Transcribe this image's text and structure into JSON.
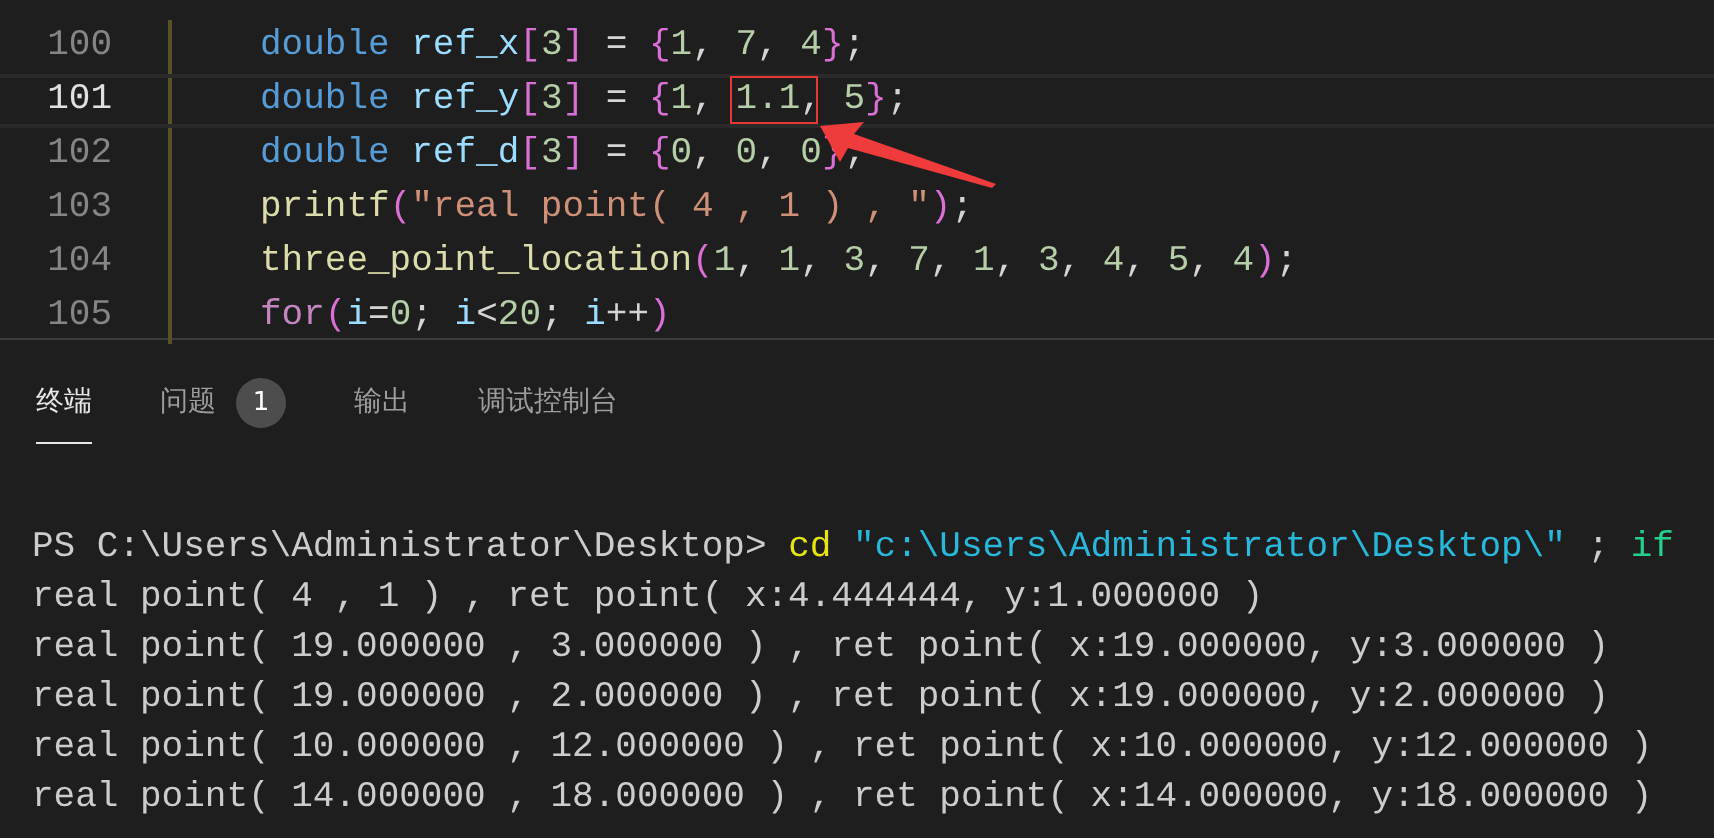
{
  "editor": {
    "lines": [
      {
        "number": "100",
        "current": false,
        "tokens": [
          {
            "kind": "keyword",
            "text": "double "
          },
          {
            "kind": "variable",
            "text": "ref_x"
          },
          {
            "kind": "bracket",
            "text": "["
          },
          {
            "kind": "number",
            "text": "3"
          },
          {
            "kind": "bracket",
            "text": "]"
          },
          {
            "kind": "punct",
            "text": " = "
          },
          {
            "kind": "bracket",
            "text": "{"
          },
          {
            "kind": "number",
            "text": "1"
          },
          {
            "kind": "punct",
            "text": ", "
          },
          {
            "kind": "number",
            "text": "7"
          },
          {
            "kind": "punct",
            "text": ", "
          },
          {
            "kind": "number",
            "text": "4"
          },
          {
            "kind": "bracket",
            "text": "}"
          },
          {
            "kind": "punct",
            "text": ";"
          }
        ]
      },
      {
        "number": "101",
        "current": true,
        "tokens": [
          {
            "kind": "keyword",
            "text": "double "
          },
          {
            "kind": "variable",
            "text": "ref_y"
          },
          {
            "kind": "bracket",
            "text": "["
          },
          {
            "kind": "number",
            "text": "3"
          },
          {
            "kind": "bracket",
            "text": "]"
          },
          {
            "kind": "punct",
            "text": " = "
          },
          {
            "kind": "bracket",
            "text": "{"
          },
          {
            "kind": "number",
            "text": "1"
          },
          {
            "kind": "punct",
            "text": ", "
          },
          {
            "kind": "number",
            "text": "1.1",
            "highlighted": true
          },
          {
            "kind": "punct",
            "text": ", "
          },
          {
            "kind": "number",
            "text": "5"
          },
          {
            "kind": "bracket",
            "text": "}"
          },
          {
            "kind": "punct",
            "text": ";"
          }
        ]
      },
      {
        "number": "102",
        "current": false,
        "tokens": [
          {
            "kind": "keyword",
            "text": "double "
          },
          {
            "kind": "variable",
            "text": "ref_d"
          },
          {
            "kind": "bracket",
            "text": "["
          },
          {
            "kind": "number",
            "text": "3"
          },
          {
            "kind": "bracket",
            "text": "]"
          },
          {
            "kind": "punct",
            "text": " = "
          },
          {
            "kind": "bracket",
            "text": "{"
          },
          {
            "kind": "number",
            "text": "0"
          },
          {
            "kind": "punct",
            "text": ", "
          },
          {
            "kind": "number",
            "text": "0"
          },
          {
            "kind": "punct",
            "text": ", "
          },
          {
            "kind": "number",
            "text": "0"
          },
          {
            "kind": "bracket",
            "text": "}"
          },
          {
            "kind": "punct",
            "text": ";"
          }
        ]
      },
      {
        "number": "103",
        "current": false,
        "tokens": [
          {
            "kind": "function",
            "text": "printf"
          },
          {
            "kind": "bracket",
            "text": "("
          },
          {
            "kind": "string",
            "text": "\"real point( 4 , 1 ) , \""
          },
          {
            "kind": "bracket",
            "text": ")"
          },
          {
            "kind": "punct",
            "text": ";"
          }
        ]
      },
      {
        "number": "104",
        "current": false,
        "tokens": [
          {
            "kind": "function",
            "text": "three_point_location"
          },
          {
            "kind": "bracket",
            "text": "("
          },
          {
            "kind": "number",
            "text": "1"
          },
          {
            "kind": "punct",
            "text": ", "
          },
          {
            "kind": "number",
            "text": "1"
          },
          {
            "kind": "punct",
            "text": ", "
          },
          {
            "kind": "number",
            "text": "3"
          },
          {
            "kind": "punct",
            "text": ", "
          },
          {
            "kind": "number",
            "text": "7"
          },
          {
            "kind": "punct",
            "text": ", "
          },
          {
            "kind": "number",
            "text": "1"
          },
          {
            "kind": "punct",
            "text": ", "
          },
          {
            "kind": "number",
            "text": "3"
          },
          {
            "kind": "punct",
            "text": ", "
          },
          {
            "kind": "number",
            "text": "4"
          },
          {
            "kind": "punct",
            "text": ", "
          },
          {
            "kind": "number",
            "text": "5"
          },
          {
            "kind": "punct",
            "text": ", "
          },
          {
            "kind": "number",
            "text": "4"
          },
          {
            "kind": "bracket",
            "text": ")"
          },
          {
            "kind": "punct",
            "text": ";"
          }
        ]
      },
      {
        "number": "105",
        "current": false,
        "tokens": [
          {
            "kind": "control",
            "text": "for"
          },
          {
            "kind": "bracket",
            "text": "("
          },
          {
            "kind": "variable",
            "text": "i"
          },
          {
            "kind": "punct",
            "text": "="
          },
          {
            "kind": "number",
            "text": "0"
          },
          {
            "kind": "punct",
            "text": "; "
          },
          {
            "kind": "variable",
            "text": "i"
          },
          {
            "kind": "punct",
            "text": "<"
          },
          {
            "kind": "number",
            "text": "20"
          },
          {
            "kind": "punct",
            "text": "; "
          },
          {
            "kind": "variable",
            "text": "i"
          },
          {
            "kind": "punct",
            "text": "++"
          },
          {
            "kind": "bracket",
            "text": ")"
          }
        ]
      }
    ]
  },
  "annotation": {
    "arrow": true
  },
  "panel": {
    "tabs": [
      {
        "label": "终端",
        "selected": true
      },
      {
        "label": "问题",
        "selected": false,
        "badge": "1"
      },
      {
        "label": "输出",
        "selected": false
      },
      {
        "label": "调试控制台",
        "selected": false
      }
    ]
  },
  "terminal": {
    "lines": [
      {
        "tokens": [
          {
            "kind": "plain",
            "text": "PS C:\\Users\\Administrator\\Desktop> "
          },
          {
            "kind": "command",
            "text": "cd"
          },
          {
            "kind": "string",
            "text": " \"c:\\Users\\Administrator\\Desktop\\\""
          },
          {
            "kind": "plain",
            "text": " ; "
          },
          {
            "kind": "keyword",
            "text": "if"
          }
        ]
      },
      {
        "tokens": [
          {
            "kind": "plain",
            "text": "real point( 4 , 1 ) , ret point( x:4.444444, y:1.000000 )"
          }
        ]
      },
      {
        "tokens": [
          {
            "kind": "plain",
            "text": "real point( 19.000000 , 3.000000 ) , ret point( x:19.000000, y:3.000000 )"
          }
        ]
      },
      {
        "tokens": [
          {
            "kind": "plain",
            "text": "real point( 19.000000 , 2.000000 ) , ret point( x:19.000000, y:2.000000 )"
          }
        ]
      },
      {
        "tokens": [
          {
            "kind": "plain",
            "text": "real point( 10.000000 , 12.000000 ) , ret point( x:10.000000, y:12.000000 )"
          }
        ]
      },
      {
        "tokens": [
          {
            "kind": "plain",
            "text": "real point( 14.000000 , 18.000000 ) , ret point( x:14.000000, y:18.000000 )"
          }
        ]
      }
    ]
  }
}
